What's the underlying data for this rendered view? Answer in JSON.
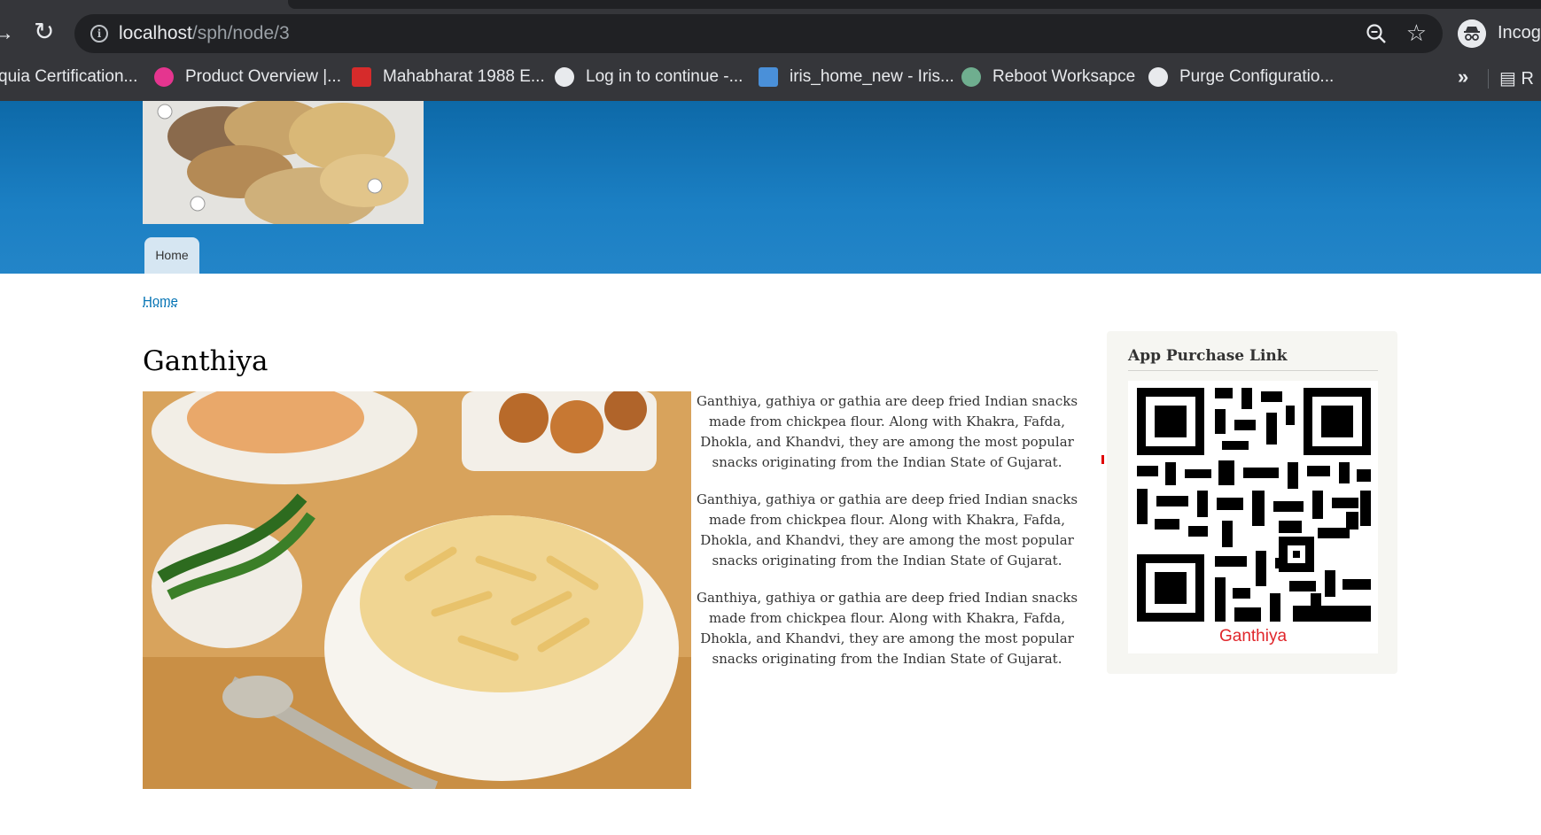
{
  "browser": {
    "url_host": "localhost",
    "url_path": "/sph/node/3",
    "profile_label": "Incogn",
    "bookmarks": [
      {
        "label": "quia Certification...",
        "color": ""
      },
      {
        "label": "Product Overview |...",
        "color": "#e5358f"
      },
      {
        "label": "Mahabharat 1988 E...",
        "color": "#d62b2b"
      },
      {
        "label": "Log in to continue -...",
        "color": "#e8eaed"
      },
      {
        "label": "iris_home_new - Iris...",
        "color": "#4a90d9"
      },
      {
        "label": "Reboot Worksapce",
        "color": "#6fae8f"
      },
      {
        "label": "Purge Configuratio...",
        "color": "#e8eaed"
      }
    ],
    "bookmarks_overflow": "»",
    "reading_list_label": "R"
  },
  "site": {
    "nav": {
      "home_tab": "Home"
    },
    "breadcrumb": "Home",
    "title": "Ganthiya",
    "paragraphs": [
      "Ganthiya, gathiya or gathia are deep fried Indian snacks made from chickpea flour. Along with Khakra, Fafda, Dhokla, and Khandvi, they are among the most popular snacks originating from the Indian State of Gujarat.",
      "Ganthiya, gathiya or gathia are deep fried Indian snacks made from chickpea flour. Along with Khakra, Fafda, Dhokla, and Khandvi, they are among the most popular snacks originating from the Indian State of Gujarat.",
      "Ganthiya, gathiya or gathia are deep fried Indian snacks made from chickpea flour. Along with Khakra, Fafda, Dhokla, and Khandvi, they are among the most popular snacks originating from the Indian State of Gujarat."
    ],
    "sidebar": {
      "block_title": "App Purchase Link",
      "qr_caption": "Ganthiya"
    },
    "colors": {
      "header_blue": "#1b7fc3",
      "link_blue": "#0071b3",
      "caption_red": "#e0262b"
    }
  }
}
